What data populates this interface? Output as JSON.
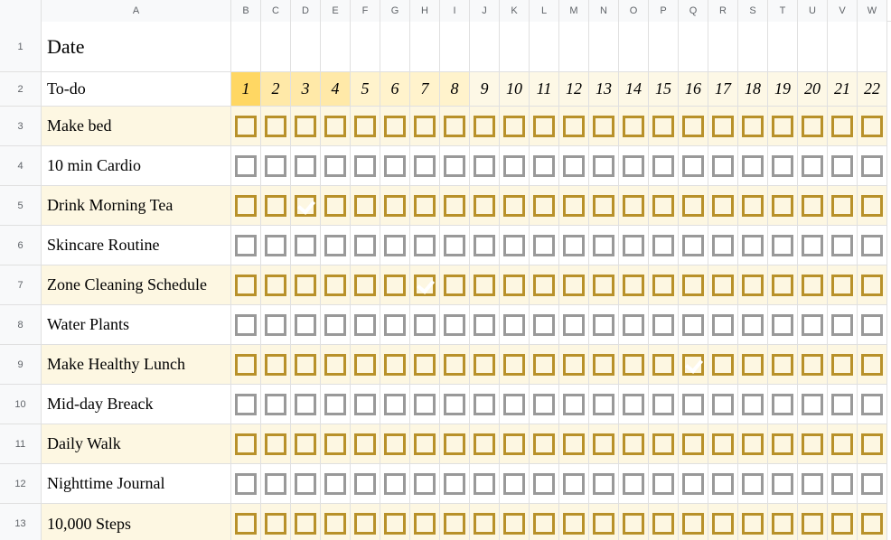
{
  "col_letters": [
    "A",
    "B",
    "C",
    "D",
    "E",
    "F",
    "G",
    "H",
    "I",
    "J",
    "K",
    "L",
    "M",
    "N",
    "O",
    "P",
    "Q",
    "R",
    "S",
    "T",
    "U",
    "V",
    "W"
  ],
  "row_numbers": [
    "1",
    "2",
    "3",
    "4",
    "5",
    "6",
    "7",
    "8",
    "9",
    "10",
    "11",
    "12",
    "13"
  ],
  "header": {
    "date_label": "Date",
    "todo_label": "To-do"
  },
  "days": [
    "1",
    "2",
    "3",
    "4",
    "5",
    "6",
    "7",
    "8",
    "9",
    "10",
    "11",
    "12",
    "13",
    "14",
    "15",
    "16",
    "17",
    "18",
    "19",
    "20",
    "21",
    "22"
  ],
  "tasks": [
    {
      "label": "Make bed",
      "shaded": true,
      "checked_days": []
    },
    {
      "label": "10 min Cardio",
      "shaded": false,
      "checked_days": []
    },
    {
      "label": "Drink Morning Tea",
      "shaded": true,
      "checked_days": [
        3
      ]
    },
    {
      "label": "Skincare Routine",
      "shaded": false,
      "checked_days": []
    },
    {
      "label": "Zone Cleaning Schedule",
      "shaded": true,
      "checked_days": [
        7
      ]
    },
    {
      "label": "Water Plants",
      "shaded": false,
      "checked_days": []
    },
    {
      "label": "Make Healthy Lunch",
      "shaded": true,
      "checked_days": [
        16
      ]
    },
    {
      "label": "Mid-day Breack",
      "shaded": false,
      "checked_days": []
    },
    {
      "label": "Daily Walk",
      "shaded": true,
      "checked_days": []
    },
    {
      "label": "Nighttime Journal",
      "shaded": false,
      "checked_days": []
    },
    {
      "label": "10,000 Steps",
      "shaded": true,
      "checked_days": []
    }
  ]
}
